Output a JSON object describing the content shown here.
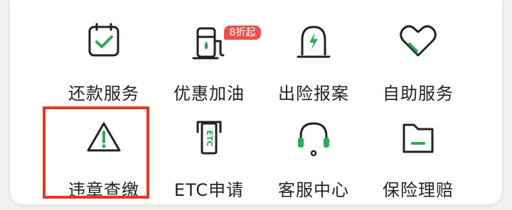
{
  "colors": {
    "accent": "#2daa58",
    "stroke": "#222222",
    "badge": "#e8504b",
    "highlight": "#e33a1f"
  },
  "services": [
    {
      "label": "还款服务",
      "icon": "calendar-check-icon"
    },
    {
      "label": "优惠加油",
      "icon": "fuel-pump-icon",
      "badge": "8折起"
    },
    {
      "label": "出险报案",
      "icon": "siren-lightning-icon"
    },
    {
      "label": "自助服务",
      "icon": "heart-icon"
    },
    {
      "label": "违章查缴",
      "icon": "warning-triangle-icon",
      "highlighted": true
    },
    {
      "label": "ETC申请",
      "icon": "etc-card-icon",
      "icon_text": "ETC"
    },
    {
      "label": "客服中心",
      "icon": "headset-icon"
    },
    {
      "label": "保险理赔",
      "icon": "folder-icon"
    }
  ]
}
